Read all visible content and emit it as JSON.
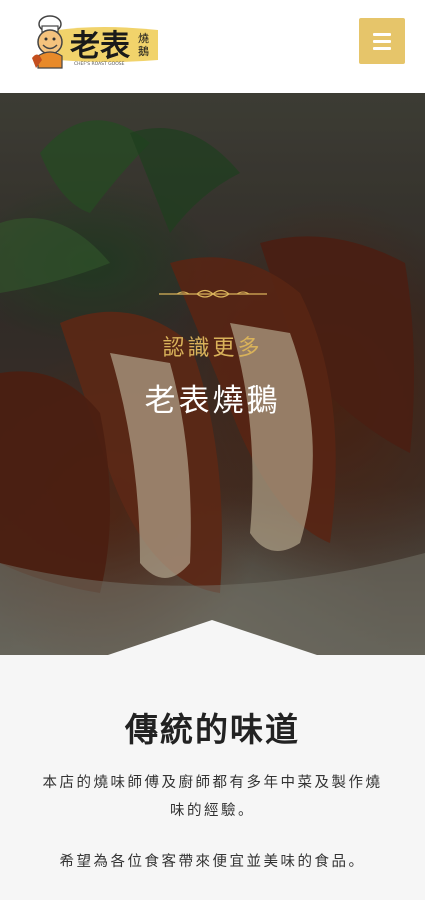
{
  "header": {
    "logo_main": "老表",
    "logo_side": "燒鵝",
    "logo_tagline": "CHEF'S ROAST GOOSE",
    "menu_icon": "hamburger-menu-icon"
  },
  "hero": {
    "subtitle": "認識更多",
    "title": "老表燒鵝"
  },
  "about": {
    "heading": "傳統的味道",
    "paragraph_1": "本店的燒味師傅及廚師都有多年中菜及製作燒味的經驗。",
    "paragraph_2": "希望為各位食客帶來便宜並美味的食品。"
  },
  "colors": {
    "accent_gold": "#e6c56a",
    "subtitle_gold": "#d9b25a",
    "content_bg": "#f6f6f6"
  }
}
